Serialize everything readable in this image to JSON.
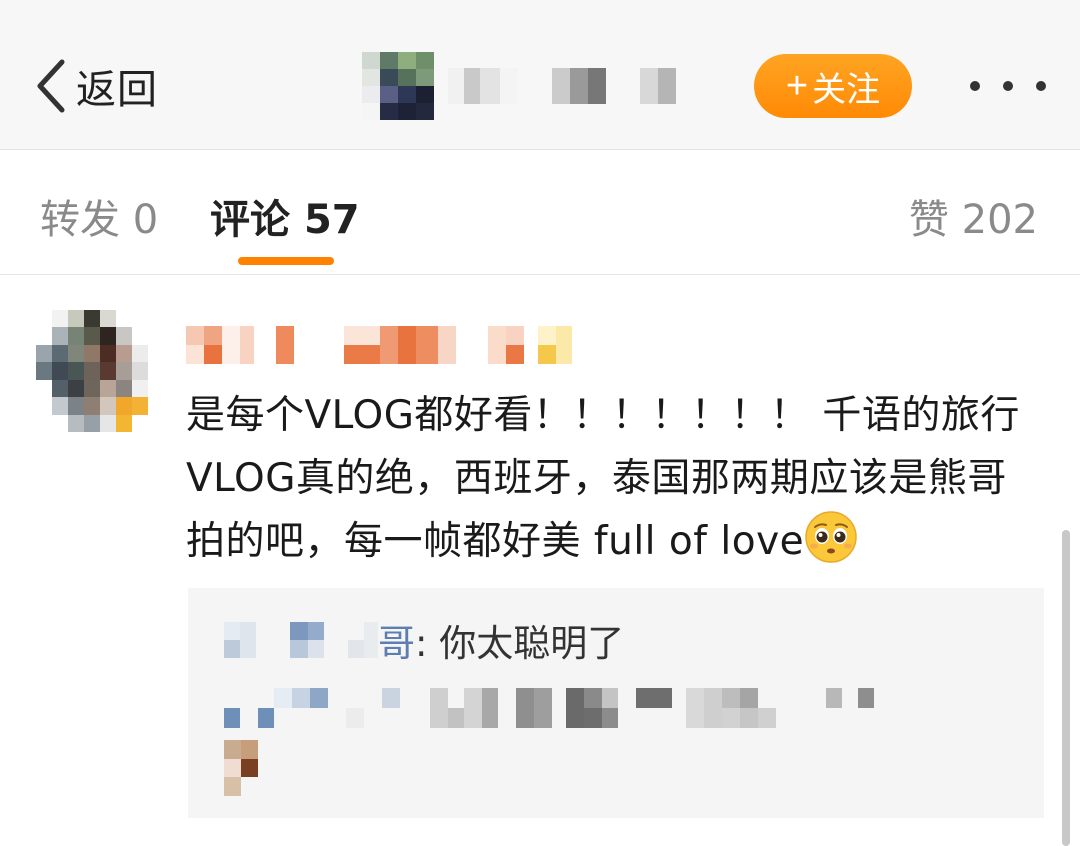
{
  "nav": {
    "back_label": "返回",
    "follow_label": "关注",
    "follow_plus": "+",
    "accent_color": "#ff8a05"
  },
  "tabs": [
    {
      "label": "转发",
      "count": "0"
    },
    {
      "label": "评论",
      "count": "57"
    },
    {
      "label": "赞",
      "count": "202"
    }
  ],
  "comment": {
    "text": "是每个VLOG都好看！！！！！！！ 千语的旅行VLOG真的绝，西班牙，泰国那两期应该是熊哥拍的吧，每一帧都好美 full of love",
    "emoji": "pleading-face-emoji"
  },
  "reply": {
    "name_suffix": "哥",
    "text": ": 你太聪明了"
  }
}
